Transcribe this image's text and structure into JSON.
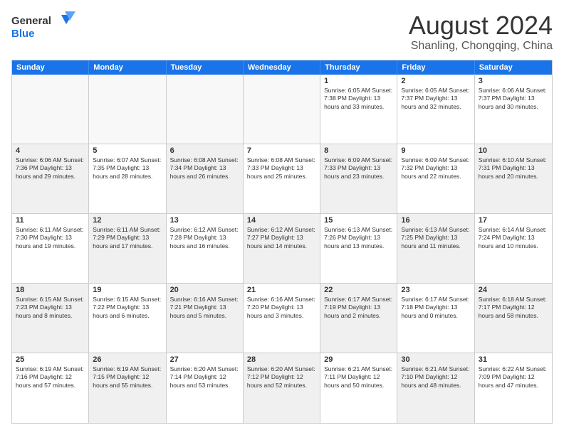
{
  "logo": {
    "line1": "General",
    "line2": "Blue"
  },
  "header": {
    "month": "August 2024",
    "location": "Shanling, Chongqing, China"
  },
  "weekdays": [
    "Sunday",
    "Monday",
    "Tuesday",
    "Wednesday",
    "Thursday",
    "Friday",
    "Saturday"
  ],
  "weeks": [
    [
      {
        "day": "",
        "info": "",
        "empty": true
      },
      {
        "day": "",
        "info": "",
        "empty": true
      },
      {
        "day": "",
        "info": "",
        "empty": true
      },
      {
        "day": "",
        "info": "",
        "empty": true
      },
      {
        "day": "1",
        "info": "Sunrise: 6:05 AM\nSunset: 7:38 PM\nDaylight: 13 hours\nand 33 minutes."
      },
      {
        "day": "2",
        "info": "Sunrise: 6:05 AM\nSunset: 7:37 PM\nDaylight: 13 hours\nand 32 minutes."
      },
      {
        "day": "3",
        "info": "Sunrise: 6:06 AM\nSunset: 7:37 PM\nDaylight: 13 hours\nand 30 minutes."
      }
    ],
    [
      {
        "day": "4",
        "info": "Sunrise: 6:06 AM\nSunset: 7:36 PM\nDaylight: 13 hours\nand 29 minutes.",
        "shaded": true
      },
      {
        "day": "5",
        "info": "Sunrise: 6:07 AM\nSunset: 7:35 PM\nDaylight: 13 hours\nand 28 minutes."
      },
      {
        "day": "6",
        "info": "Sunrise: 6:08 AM\nSunset: 7:34 PM\nDaylight: 13 hours\nand 26 minutes.",
        "shaded": true
      },
      {
        "day": "7",
        "info": "Sunrise: 6:08 AM\nSunset: 7:33 PM\nDaylight: 13 hours\nand 25 minutes."
      },
      {
        "day": "8",
        "info": "Sunrise: 6:09 AM\nSunset: 7:33 PM\nDaylight: 13 hours\nand 23 minutes.",
        "shaded": true
      },
      {
        "day": "9",
        "info": "Sunrise: 6:09 AM\nSunset: 7:32 PM\nDaylight: 13 hours\nand 22 minutes."
      },
      {
        "day": "10",
        "info": "Sunrise: 6:10 AM\nSunset: 7:31 PM\nDaylight: 13 hours\nand 20 minutes.",
        "shaded": true
      }
    ],
    [
      {
        "day": "11",
        "info": "Sunrise: 6:11 AM\nSunset: 7:30 PM\nDaylight: 13 hours\nand 19 minutes."
      },
      {
        "day": "12",
        "info": "Sunrise: 6:11 AM\nSunset: 7:29 PM\nDaylight: 13 hours\nand 17 minutes.",
        "shaded": true
      },
      {
        "day": "13",
        "info": "Sunrise: 6:12 AM\nSunset: 7:28 PM\nDaylight: 13 hours\nand 16 minutes."
      },
      {
        "day": "14",
        "info": "Sunrise: 6:12 AM\nSunset: 7:27 PM\nDaylight: 13 hours\nand 14 minutes.",
        "shaded": true
      },
      {
        "day": "15",
        "info": "Sunrise: 6:13 AM\nSunset: 7:26 PM\nDaylight: 13 hours\nand 13 minutes."
      },
      {
        "day": "16",
        "info": "Sunrise: 6:13 AM\nSunset: 7:25 PM\nDaylight: 13 hours\nand 11 minutes.",
        "shaded": true
      },
      {
        "day": "17",
        "info": "Sunrise: 6:14 AM\nSunset: 7:24 PM\nDaylight: 13 hours\nand 10 minutes."
      }
    ],
    [
      {
        "day": "18",
        "info": "Sunrise: 6:15 AM\nSunset: 7:23 PM\nDaylight: 13 hours\nand 8 minutes.",
        "shaded": true
      },
      {
        "day": "19",
        "info": "Sunrise: 6:15 AM\nSunset: 7:22 PM\nDaylight: 13 hours\nand 6 minutes."
      },
      {
        "day": "20",
        "info": "Sunrise: 6:16 AM\nSunset: 7:21 PM\nDaylight: 13 hours\nand 5 minutes.",
        "shaded": true
      },
      {
        "day": "21",
        "info": "Sunrise: 6:16 AM\nSunset: 7:20 PM\nDaylight: 13 hours\nand 3 minutes."
      },
      {
        "day": "22",
        "info": "Sunrise: 6:17 AM\nSunset: 7:19 PM\nDaylight: 13 hours\nand 2 minutes.",
        "shaded": true
      },
      {
        "day": "23",
        "info": "Sunrise: 6:17 AM\nSunset: 7:18 PM\nDaylight: 13 hours\nand 0 minutes."
      },
      {
        "day": "24",
        "info": "Sunrise: 6:18 AM\nSunset: 7:17 PM\nDaylight: 12 hours\nand 58 minutes.",
        "shaded": true
      }
    ],
    [
      {
        "day": "25",
        "info": "Sunrise: 6:19 AM\nSunset: 7:16 PM\nDaylight: 12 hours\nand 57 minutes."
      },
      {
        "day": "26",
        "info": "Sunrise: 6:19 AM\nSunset: 7:15 PM\nDaylight: 12 hours\nand 55 minutes.",
        "shaded": true
      },
      {
        "day": "27",
        "info": "Sunrise: 6:20 AM\nSunset: 7:14 PM\nDaylight: 12 hours\nand 53 minutes."
      },
      {
        "day": "28",
        "info": "Sunrise: 6:20 AM\nSunset: 7:12 PM\nDaylight: 12 hours\nand 52 minutes.",
        "shaded": true
      },
      {
        "day": "29",
        "info": "Sunrise: 6:21 AM\nSunset: 7:11 PM\nDaylight: 12 hours\nand 50 minutes."
      },
      {
        "day": "30",
        "info": "Sunrise: 6:21 AM\nSunset: 7:10 PM\nDaylight: 12 hours\nand 48 minutes.",
        "shaded": true
      },
      {
        "day": "31",
        "info": "Sunrise: 6:22 AM\nSunset: 7:09 PM\nDaylight: 12 hours\nand 47 minutes."
      }
    ]
  ]
}
